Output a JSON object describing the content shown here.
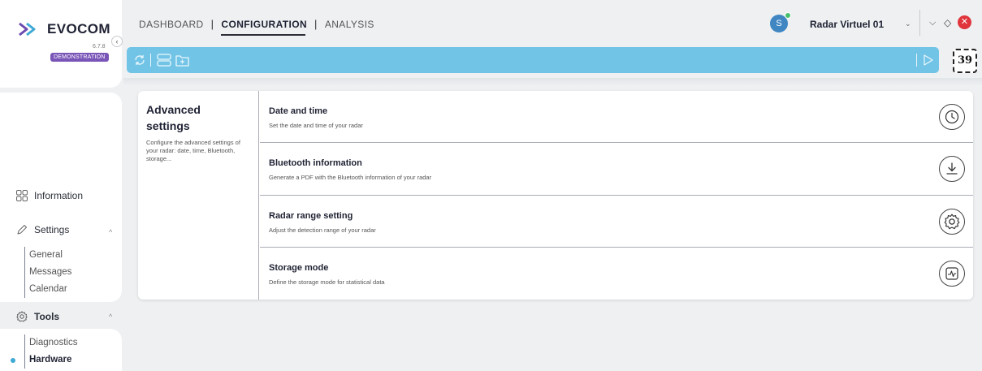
{
  "brand": {
    "name": "EVOCOM",
    "version": "6.7.8",
    "badge": "DEMONSTRATION"
  },
  "sidebar": {
    "information": "Information",
    "settings": {
      "label": "Settings",
      "items": [
        "General",
        "Messages",
        "Calendar"
      ]
    },
    "tools": {
      "label": "Tools",
      "items": [
        "Diagnostics",
        "Hardware"
      ],
      "active": "Hardware"
    }
  },
  "header": {
    "tabs": [
      {
        "label": "DASHBOARD",
        "active": false
      },
      {
        "label": "CONFIGURATION",
        "active": true
      },
      {
        "label": "ANALYSIS",
        "active": false
      }
    ],
    "avatar_initial": "S",
    "radar_name": "Radar Virtuel 01"
  },
  "toolbar": {
    "counter": "39"
  },
  "advanced": {
    "title": "Advanced settings",
    "description": "Configure the advanced settings of your radar: date, time, Bluetooth, storage...",
    "rows": [
      {
        "title": "Date and time",
        "subtitle": "Set the date and time of your radar",
        "icon": "clock-icon"
      },
      {
        "title": "Bluetooth information",
        "subtitle": "Generate a PDF with the Bluetooth information of your radar",
        "icon": "download-icon"
      },
      {
        "title": "Radar range setting",
        "subtitle": "Adjust the detection range of your radar",
        "icon": "gear-icon"
      },
      {
        "title": "Storage mode",
        "subtitle": "Define the storage mode for statistical data",
        "icon": "chart-icon"
      }
    ]
  },
  "colors": {
    "toolbar": "#72c4e6",
    "brand_badge": "#7a55b8",
    "close": "#e0353b",
    "status_online": "#48c06c",
    "active_dot": "#3fa9d6"
  }
}
